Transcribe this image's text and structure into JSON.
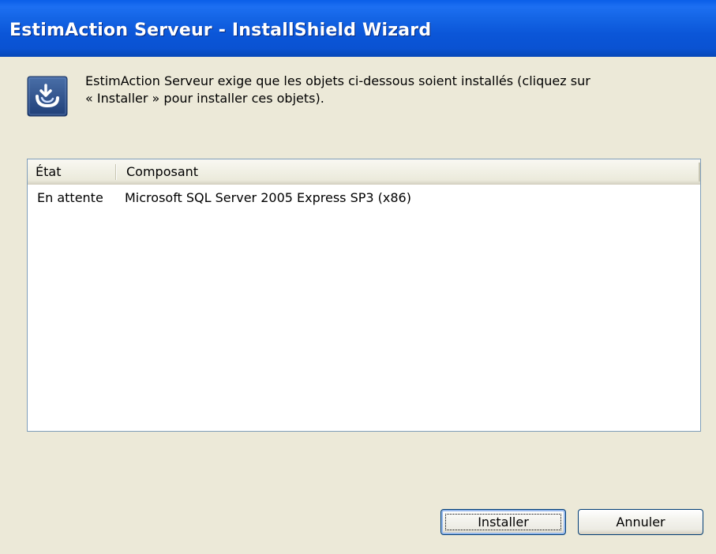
{
  "window": {
    "title": "EstimAction Serveur - InstallShield Wizard"
  },
  "intro": {
    "icon": "installshield-icon",
    "line1": "EstimAction Serveur exige que les objets ci-dessous soient installés (cliquez sur",
    "line2": "« Installer » pour installer ces objets)."
  },
  "list": {
    "columns": [
      "État",
      "Composant"
    ],
    "rows": [
      {
        "etat": "En attente",
        "composant": "Microsoft SQL Server 2005 Express SP3 (x86)"
      }
    ]
  },
  "buttons": {
    "install_label": "Installer",
    "cancel_label": "Annuler"
  },
  "colors": {
    "titlebar": "#0a52d2",
    "dialog_bg": "#ece9d8",
    "button_border": "#003c74"
  }
}
